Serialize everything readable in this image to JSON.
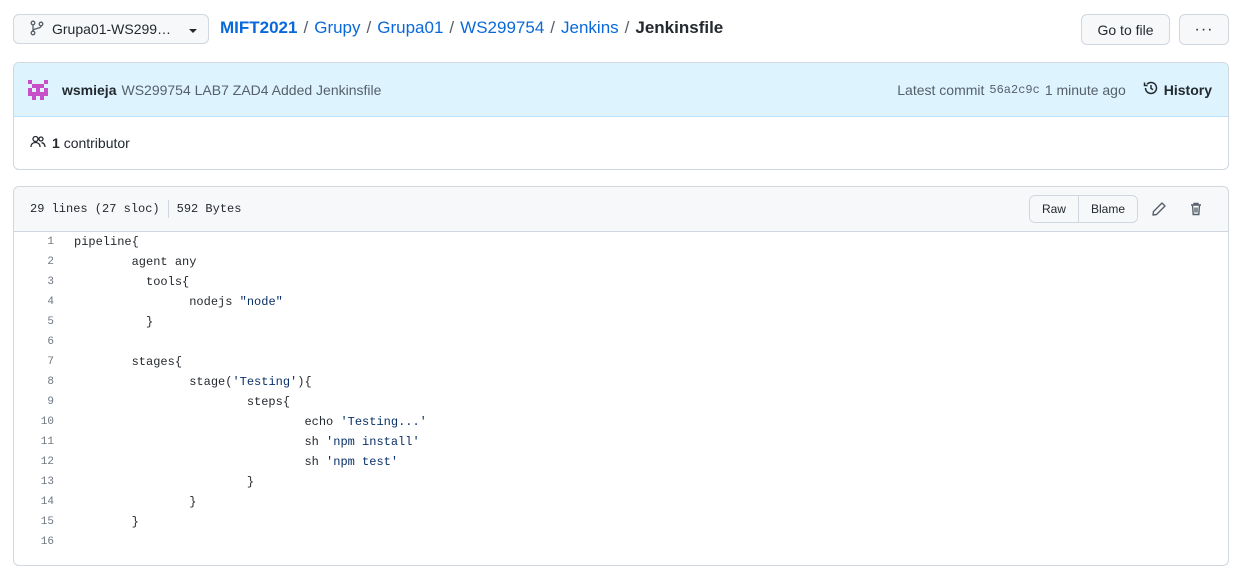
{
  "branch": {
    "label": "Grupa01-WS299…"
  },
  "breadcrumb": {
    "repo": "MIFT2021",
    "parts": [
      "Grupy",
      "Grupa01",
      "WS299754",
      "Jenkins"
    ],
    "current": "Jenkinsfile",
    "separator": "/"
  },
  "header": {
    "goto_label": "Go to file",
    "more_label": "···"
  },
  "commit": {
    "author": "wsmieja",
    "message": "WS299754 LAB7 ZAD4 Added Jenkinsfile",
    "latest_label": "Latest commit",
    "sha": "56a2c9c",
    "time": "1 minute ago",
    "history_label": "History"
  },
  "contributors": {
    "count": "1",
    "label": "contributor"
  },
  "file": {
    "lines_info": "29 lines (27 sloc)",
    "size": "592 Bytes",
    "raw_label": "Raw",
    "blame_label": "Blame"
  },
  "code_lines": [
    {
      "n": "1",
      "pre": "pipeline{",
      "str": "",
      "post": ""
    },
    {
      "n": "2",
      "pre": "        agent any",
      "str": "",
      "post": ""
    },
    {
      "n": "3",
      "pre": "          tools{",
      "str": "",
      "post": ""
    },
    {
      "n": "4",
      "pre": "                nodejs ",
      "str": "\"node\"",
      "post": ""
    },
    {
      "n": "5",
      "pre": "          }",
      "str": "",
      "post": ""
    },
    {
      "n": "6",
      "pre": "",
      "str": "",
      "post": ""
    },
    {
      "n": "7",
      "pre": "        stages{",
      "str": "",
      "post": ""
    },
    {
      "n": "8",
      "pre": "                stage(",
      "str": "'Testing'",
      "post": "){"
    },
    {
      "n": "9",
      "pre": "                        steps{",
      "str": "",
      "post": ""
    },
    {
      "n": "10",
      "pre": "                                echo ",
      "str": "'Testing...'",
      "post": ""
    },
    {
      "n": "11",
      "pre": "                                sh ",
      "str": "'npm install'",
      "post": ""
    },
    {
      "n": "12",
      "pre": "                                sh ",
      "str": "'npm test'",
      "post": ""
    },
    {
      "n": "13",
      "pre": "                        }",
      "str": "",
      "post": ""
    },
    {
      "n": "14",
      "pre": "                }",
      "str": "",
      "post": ""
    },
    {
      "n": "15",
      "pre": "        }",
      "str": "",
      "post": ""
    },
    {
      "n": "16",
      "pre": "",
      "str": "",
      "post": ""
    }
  ],
  "colors": {
    "link": "#0969da",
    "commit_bg": "#ddf4ff",
    "avatar": "#c84fc8",
    "string": "#0a3069"
  }
}
